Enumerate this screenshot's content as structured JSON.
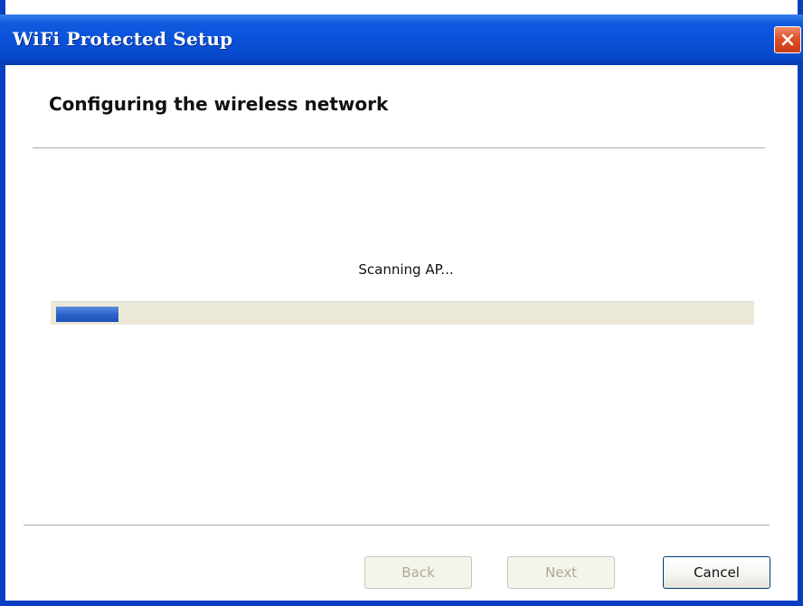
{
  "window": {
    "title": "WiFi Protected Setup",
    "close_icon": "close-icon"
  },
  "main": {
    "heading": "Configuring the wireless network",
    "status": "Scanning AP...",
    "progress": 0.09
  },
  "footer": {
    "back_label": "Back",
    "back_enabled": false,
    "next_label": "Next",
    "next_enabled": false,
    "cancel_label": "Cancel",
    "cancel_enabled": true
  },
  "colors": {
    "titlebar": "#0a50d8",
    "progress_fill": "#2d63c8",
    "progress_track": "#ece9d8",
    "close_button": "#e0502a"
  }
}
